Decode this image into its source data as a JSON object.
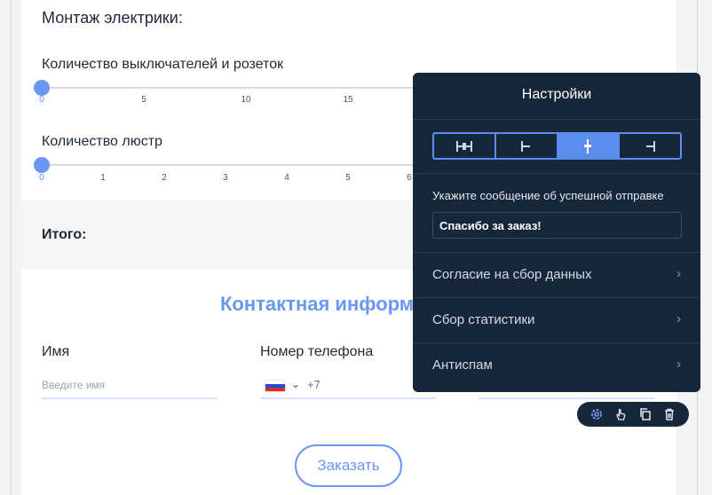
{
  "form": {
    "section_title": "Монтаж электрики:",
    "sliders": [
      {
        "label": "Количество выключателей и розеток",
        "value": 0,
        "ticks": [
          "0",
          "5",
          "10",
          "15"
        ]
      },
      {
        "label": "Количество люстр",
        "value": 0,
        "ticks": [
          "0",
          "1",
          "2",
          "3",
          "4",
          "5",
          "6"
        ]
      }
    ],
    "total_label": "Итого:",
    "contact_title": "Контактная информ",
    "name_field": {
      "label": "Имя",
      "placeholder": "Введите имя"
    },
    "phone_field": {
      "label": "Номер телефона",
      "prefix": "+7"
    },
    "order_button": "Заказать"
  },
  "settings_panel": {
    "title": "Настройки",
    "alignment_options": [
      "fill",
      "left",
      "center",
      "right"
    ],
    "alignment_selected": "center",
    "success_message": {
      "label": "Укажите сообщение об успешной отправке",
      "value": "Спасибо за заказ!"
    },
    "rows": [
      {
        "label": "Согласие на сбор данных"
      },
      {
        "label": "Сбор статистики"
      },
      {
        "label": "Антиспам"
      }
    ],
    "chevron": "›"
  },
  "toolbar": {
    "tools": [
      "gear-icon",
      "hand-pointer-icon",
      "copy-icon",
      "trash-icon"
    ]
  },
  "colors": {
    "accent": "#6b96f2",
    "panel_bg": "#17273a",
    "text": "#1e2a3a"
  }
}
